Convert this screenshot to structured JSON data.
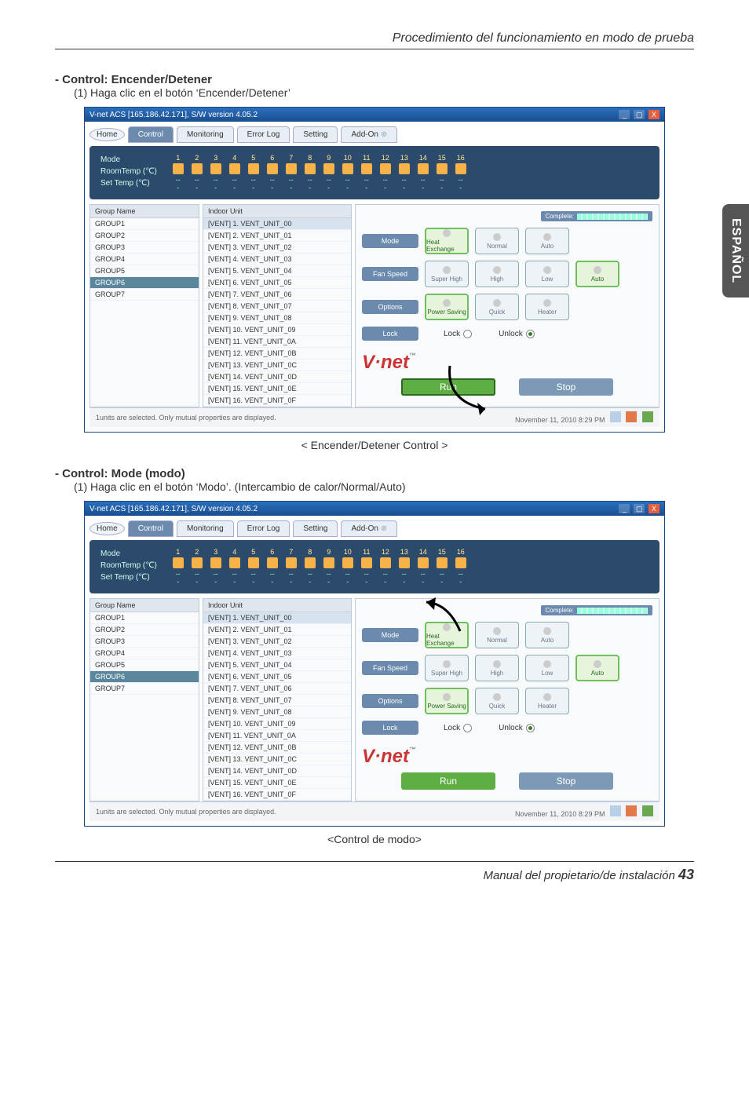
{
  "page": {
    "running_header": "Procedimiento del funcionamiento en modo de prueba",
    "side_tab": "ESPAÑOL",
    "footer_text": "Manual del propietario/de instalación",
    "page_number": "43"
  },
  "section1": {
    "title": "- Control: Encender/Detener",
    "subtitle": "(1) Haga clic en el botón ‘Encender/Detener’",
    "caption": "< Encender/Detener Control >"
  },
  "section2": {
    "title": "- Control: Mode (modo)",
    "subtitle": "(1) Haga clic en el botón ‘Modo’. (Intercambio de calor/Normal/Auto)",
    "caption": "<Control de modo>"
  },
  "window": {
    "title": "V-net ACS [165.186.42.171],   S/W version 4.05.2",
    "tabs": {
      "home": "Home",
      "control": "Control",
      "monitoring": "Monitoring",
      "errorlog": "Error Log",
      "setting": "Setting",
      "addon": "Add-On"
    },
    "status_panel": {
      "mode": "Mode",
      "roomtemp": "RoomTemp (℃)",
      "settemp": "Set Temp  (℃)",
      "col_numbers": [
        "1",
        "2",
        "3",
        "4",
        "5",
        "6",
        "7",
        "8",
        "9",
        "10",
        "11",
        "12",
        "13",
        "14",
        "15",
        "16"
      ]
    },
    "groups_header": "Group Name",
    "groups": [
      "GROUP1",
      "GROUP2",
      "GROUP3",
      "GROUP4",
      "GROUP5",
      "GROUP6",
      "GROUP7"
    ],
    "groups_selected_index": 5,
    "units_header": "Indoor Unit",
    "units": [
      "[VENT] 1. VENT_UNIT_00",
      "[VENT] 2. VENT_UNIT_01",
      "[VENT] 3. VENT_UNIT_02",
      "[VENT] 4. VENT_UNIT_03",
      "[VENT] 5. VENT_UNIT_04",
      "[VENT] 6. VENT_UNIT_05",
      "[VENT] 7. VENT_UNIT_06",
      "[VENT] 8. VENT_UNIT_07",
      "[VENT] 9. VENT_UNIT_08",
      "[VENT] 10. VENT_UNIT_09",
      "[VENT] 11. VENT_UNIT_0A",
      "[VENT] 12. VENT_UNIT_0B",
      "[VENT] 13. VENT_UNIT_0C",
      "[VENT] 14. VENT_UNIT_0D",
      "[VENT] 15. VENT_UNIT_0E",
      "[VENT] 16. VENT_UNIT_0F"
    ],
    "complete_label": "Complete:",
    "controls": {
      "mode": {
        "label": "Mode",
        "opts": [
          "Heat Exchange",
          "Normal",
          "Auto"
        ]
      },
      "fan": {
        "label": "Fan Speed",
        "opts": [
          "Super High",
          "High",
          "Low",
          "Auto"
        ]
      },
      "options": {
        "label": "Options",
        "opts": [
          "Power Saving",
          "Quick",
          "Heater"
        ]
      },
      "lock": {
        "label": "Lock",
        "lock": "Lock",
        "unlock": "Unlock"
      }
    },
    "logo": "V·net",
    "logo_tm": "™",
    "run": "Run",
    "stop": "Stop",
    "statusbar_left": "1units are selected. Only mutual properties are displayed.",
    "statusbar_right": "November 11, 2010  8:29 PM"
  }
}
